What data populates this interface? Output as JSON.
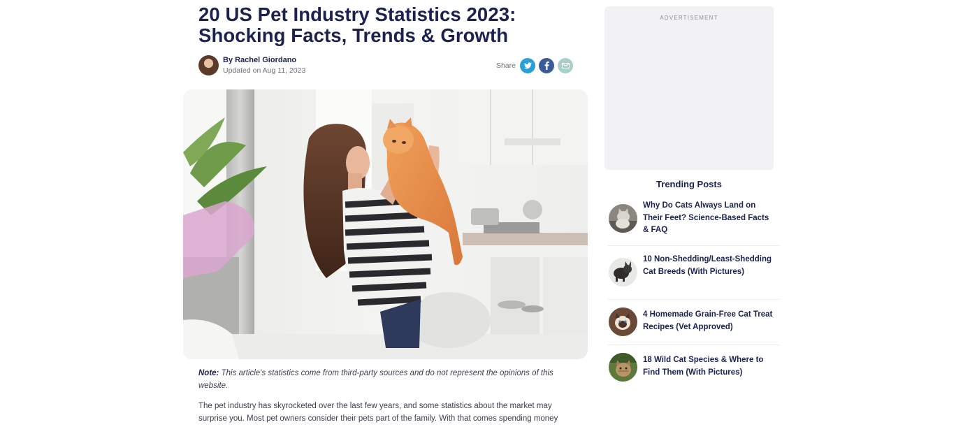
{
  "article": {
    "title": "20 US Pet Industry Statistics 2023: Shocking Facts, Trends & Growth",
    "author": "By Rachel Giordano",
    "updated": "Updated on Aug 11, 2023",
    "share_label": "Share",
    "share_buttons": [
      {
        "name": "twitter",
        "glyph": "t",
        "color": "#2a9fd8"
      },
      {
        "name": "facebook",
        "glyph": "f",
        "color": "#3b5a99"
      },
      {
        "name": "email",
        "glyph": "✉",
        "color": "#a9d0c6"
      }
    ],
    "note_label": "Note:",
    "note_text": " This article's statistics come from third-party sources and do not represent the opinions of this website.",
    "paragraph": "The pet industry has skyrocketed over the last few years, and some statistics about the market may surprise you. Most pet owners consider their pets part of the family. With that comes spending money"
  },
  "sidebar": {
    "ad_label": "ADVERTISEMENT",
    "trending_title": "Trending Posts",
    "trending": [
      {
        "title": "Why Do Cats Always Land on Their Feet? Science-Based Facts & FAQ",
        "thumb": "gray-cat-thumbnail"
      },
      {
        "title": "10 Non-Shedding/Least-Shedding Cat Breeds (With Pictures)",
        "thumb": "black-cat-thumbnail"
      },
      {
        "title": "4 Homemade Grain-Free Cat Treat Recipes (Vet Approved)",
        "thumb": "siamese-cat-thumbnail"
      },
      {
        "title": "18 Wild Cat Species & Where to Find Them (With Pictures)",
        "thumb": "wild-cat-thumbnail"
      }
    ]
  },
  "colors": {
    "heading": "#1c2150",
    "muted": "#6b6f7d",
    "ad_background": "#f2f2f4"
  }
}
